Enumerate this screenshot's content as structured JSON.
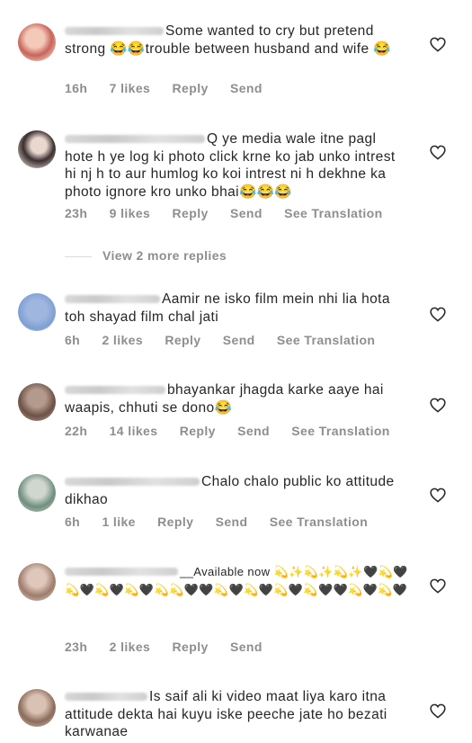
{
  "comments": [
    {
      "text": "Some wanted to cry but pretend strong 😂😂trouble between husband and wife 😂",
      "time": "16h",
      "likes": "7 likes",
      "reply": "Reply",
      "send": "Send",
      "translation": ""
    },
    {
      "text": "Q ye media wale itne pagl hote h ye log ki photo click krne ko jab unko intrest hi nj h to aur humlog ko koi intrest ni h dekhne ka photo ignore kro unko bhai😂😂😂",
      "time": "23h",
      "likes": "9 likes",
      "reply": "Reply",
      "send": "Send",
      "translation": "See Translation"
    },
    {
      "text": "Aamir ne isko film mein nhi lia hota toh shayad film chal jati",
      "time": "6h",
      "likes": "2 likes",
      "reply": "Reply",
      "send": "Send",
      "translation": "See Translation"
    },
    {
      "text": "bhayankar jhagda karke aaye hai waapis, chhuti se dono😂",
      "time": "22h",
      "likes": "14 likes",
      "reply": "Reply",
      "send": "Send",
      "translation": "See Translation"
    },
    {
      "text": "Chalo chalo public ko attitude dikhao",
      "time": "6h",
      "likes": "1 like",
      "reply": "Reply",
      "send": "Send",
      "translation": "See Translation"
    },
    {
      "text": "__Available now 💫✨💫✨💫✨🖤💫🖤💫🖤💫🖤💫🖤💫💫🖤🖤💫🖤💫🖤💫🖤💫🖤🖤💫🖤💫🖤",
      "time": "23h",
      "likes": "2 likes",
      "reply": "Reply",
      "send": "Send",
      "translation": ""
    },
    {
      "text": "Is saif ali ki video maat liya karo itna attitude dekta hai kuyu iske peeche jate ho bezati karwanae",
      "time": "",
      "likes": "",
      "reply": "",
      "send": "",
      "translation": ""
    }
  ],
  "view_more": "View 2 more replies",
  "icons": {
    "heart": "heart-outline-icon"
  },
  "colors": {
    "text": "#262626",
    "meta": "#8e8e8e"
  }
}
